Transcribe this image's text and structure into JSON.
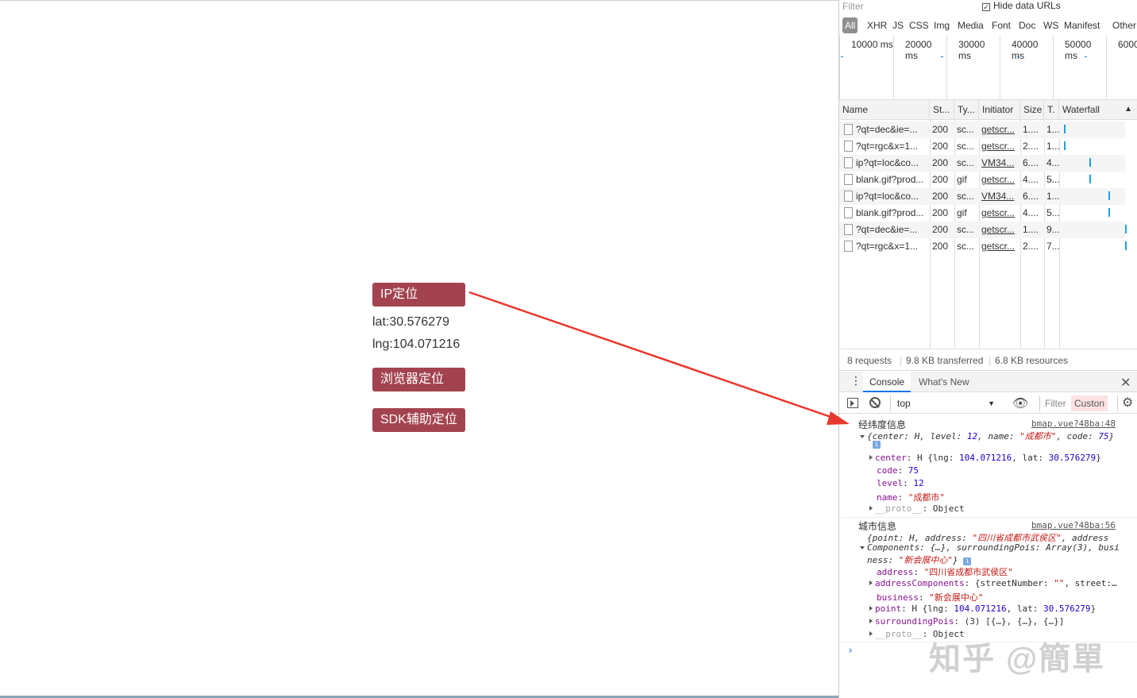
{
  "page": {
    "buttons": {
      "ip": "IP定位",
      "browser": "浏览器定位",
      "sdk": "SDK辅助定位"
    },
    "lat": "lat:30.576279",
    "lng": "lng:104.071216"
  },
  "devtools": {
    "filter_placeholder": "Filter",
    "hide_data_urls": "Hide data URLs",
    "types": [
      "All",
      "XHR",
      "JS",
      "CSS",
      "Img",
      "Media",
      "Font",
      "Doc",
      "WS",
      "Manifest",
      "Other"
    ],
    "timeline": [
      "10000 ms",
      "20000 ms",
      "30000 ms",
      "40000 ms",
      "50000 ms",
      "6000"
    ],
    "columns": [
      "Name",
      "St...",
      "Ty...",
      "Initiator",
      "Size",
      "T.",
      "Waterfall"
    ],
    "requests": [
      {
        "name": "?qt=dec&ie=...",
        "status": "200",
        "type": "sc...",
        "initiator": "getscr...",
        "size": "1....",
        "time": "1..."
      },
      {
        "name": "?qt=rgc&x=1...",
        "status": "200",
        "type": "sc...",
        "initiator": "getscr...",
        "size": "2....",
        "time": "1..."
      },
      {
        "name": "ip?qt=loc&co...",
        "status": "200",
        "type": "sc...",
        "initiator": "VM34...",
        "size": "6....",
        "time": "4..."
      },
      {
        "name": "blank.gif?prod...",
        "status": "200",
        "type": "gif",
        "initiator": "getscr...",
        "size": "4....",
        "time": "5..."
      },
      {
        "name": "ip?qt=loc&co...",
        "status": "200",
        "type": "sc...",
        "initiator": "VM34...",
        "size": "6....",
        "time": "1..."
      },
      {
        "name": "blank.gif?prod...",
        "status": "200",
        "type": "gif",
        "initiator": "getscr...",
        "size": "4....",
        "time": "5..."
      },
      {
        "name": "?qt=dec&ie=...",
        "status": "200",
        "type": "sc...",
        "initiator": "getscr...",
        "size": "1....",
        "time": "9..."
      },
      {
        "name": "?qt=rgc&x=1...",
        "status": "200",
        "type": "sc...",
        "initiator": "getscr...",
        "size": "2....",
        "time": "7..."
      }
    ],
    "summary": {
      "requests": "8 requests",
      "transferred": "9.8 KB transferred",
      "resources": "6.8 KB resources"
    },
    "console_tabs": [
      "Console",
      "What's New"
    ],
    "context": "top",
    "console_filter": "Filter",
    "custom_levels": "Custon",
    "logs": {
      "geo_title": "经纬度信息",
      "geo_src": "bmap.vue?48ba:48",
      "city_title": "城市信息",
      "city_src": "bmap.vue?48ba:56"
    }
  },
  "watermark": "知乎 @簡單"
}
